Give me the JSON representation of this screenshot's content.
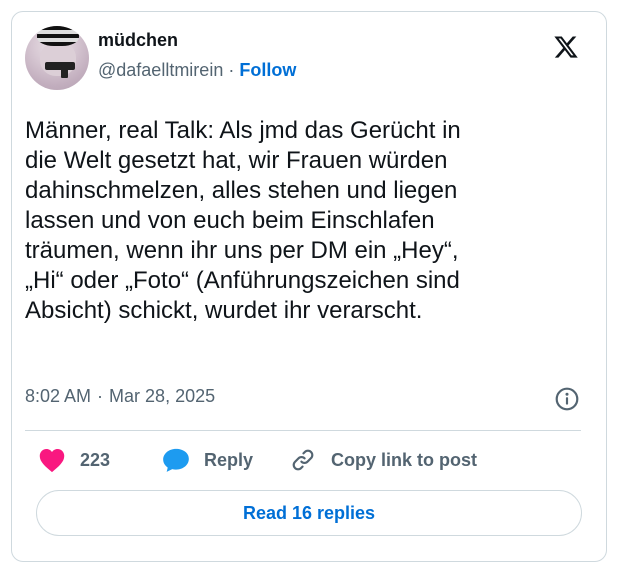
{
  "author": {
    "name": "müdchen",
    "handle": "@dafaelltmirein",
    "separator": "·",
    "follow_label": "Follow"
  },
  "tweet": {
    "text": "Männer, real Talk: Als jmd das Gerücht in\ndie Welt gesetzt hat, wir Frauen würden\ndahinschmelzen, alles stehen und liegen\nlassen und von euch beim Einschlafen\nträumen, wenn ihr uns per DM ein „Hey“,\n„Hi“ oder „Foto“ (Anführungszeichen sind\nAbsicht) schickt, wurdet ihr verarscht.",
    "time": "8:02 AM",
    "separator": "·",
    "date": "Mar 28, 2025"
  },
  "actions": {
    "like_count": "223",
    "reply_label": "Reply",
    "copy_label": "Copy link to post"
  },
  "read_replies_label": "Read 16 replies",
  "icons": {
    "logo": "x-logo-icon",
    "info": "info-icon",
    "like": "heart-icon",
    "reply": "speech-bubble-icon",
    "copy": "link-icon"
  },
  "colors": {
    "accent": "#006fd6",
    "like": "#f91880",
    "reply": "#1d9bf0",
    "muted": "#536471",
    "border": "#cfd9de"
  }
}
